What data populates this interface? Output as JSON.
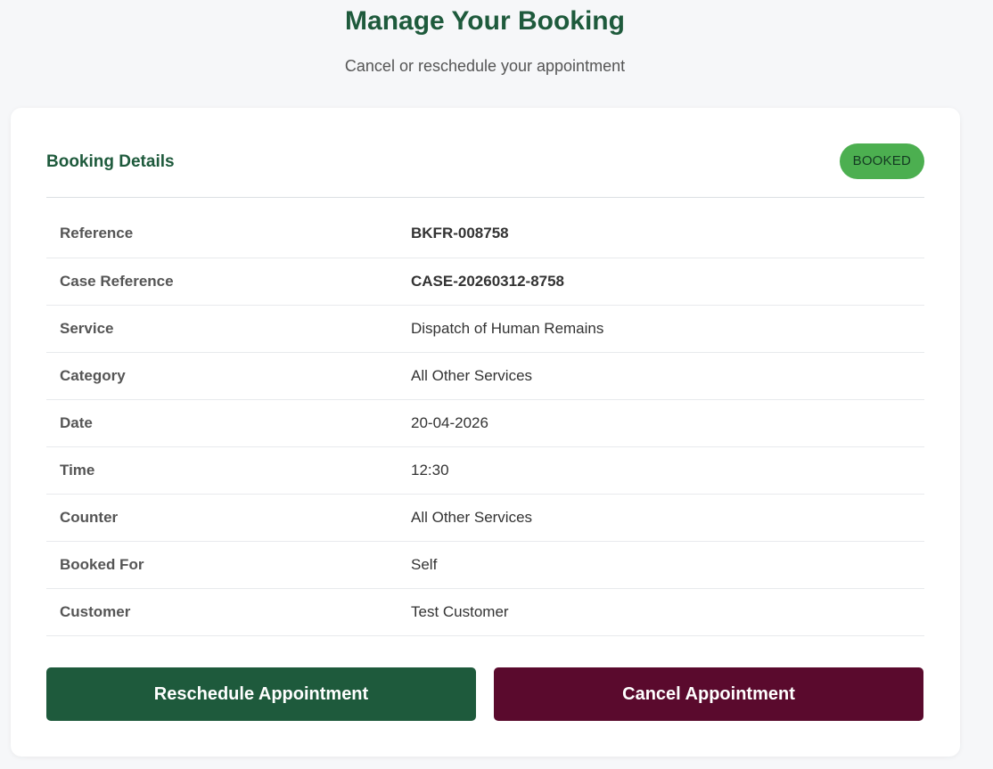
{
  "page": {
    "title": "Manage Your Booking",
    "subtitle": "Cancel or reschedule your appointment"
  },
  "card": {
    "title": "Booking Details",
    "status": "BOOKED",
    "status_color": "#4caf50"
  },
  "details": [
    {
      "label": "Reference",
      "value": "BKFR-008758"
    },
    {
      "label": "Case Reference",
      "value": "CASE-20260312-8758"
    },
    {
      "label": "Service",
      "value": "Dispatch of Human Remains"
    },
    {
      "label": "Category",
      "value": "All Other Services"
    },
    {
      "label": "Date",
      "value": "20-04-2026"
    },
    {
      "label": "Time",
      "value": "12:30"
    },
    {
      "label": "Counter",
      "value": "All Other Services"
    },
    {
      "label": "Booked For",
      "value": "Self"
    },
    {
      "label": "Customer",
      "value": "Test Customer"
    }
  ],
  "actions": {
    "reschedule_label": "Reschedule Appointment",
    "cancel_label": "Cancel Appointment"
  },
  "colors": {
    "brand_green": "#1e5a3c",
    "cancel_maroon": "#5a0a2d",
    "background": "#f6f7f9"
  }
}
